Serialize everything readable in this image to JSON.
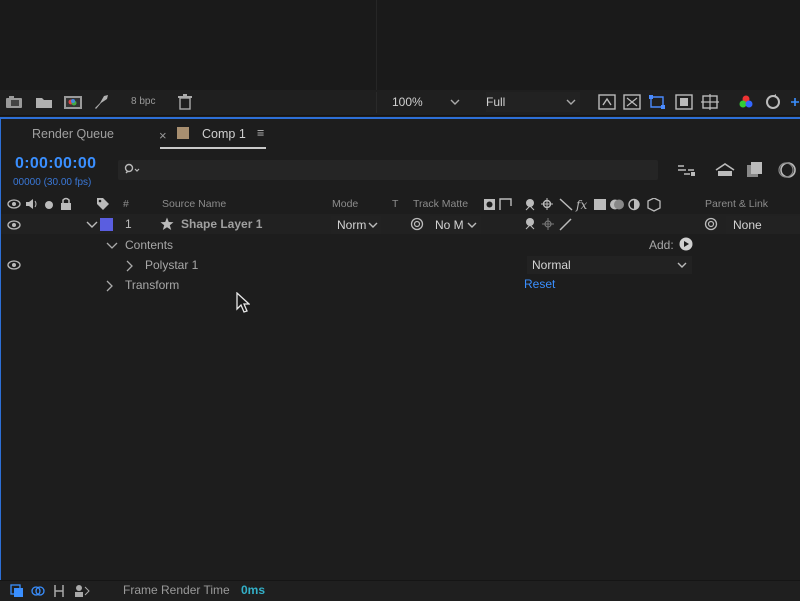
{
  "toolbar": {
    "bpc": "8 bpc",
    "zoom": "100%",
    "resolution": "Full",
    "icons": [
      "screenshot-icon",
      "folder-icon",
      "color-picture-icon",
      "rocket-icon",
      "trash-icon",
      "fast-preview-icon",
      "transparency-grid-icon",
      "mask-path-icon",
      "region-of-interest-icon",
      "grid-guides-icon",
      "channels-icon",
      "reset-exposure-icon"
    ],
    "accent": "#2d6fd6"
  },
  "tabs": {
    "render_queue": "Render Queue",
    "close": "×",
    "comp": "Comp 1",
    "menu": "≡"
  },
  "timeline": {
    "timecode": "0:00:00:00",
    "frame_info": "00000 (30.00 fps)",
    "timecode_color": "#3a8fff"
  },
  "columns": {
    "num": "#",
    "source_name": "Source Name",
    "mode": "Mode",
    "t": "T",
    "track_matte": "Track Matte",
    "parent_link": "Parent & Link"
  },
  "layer": {
    "number": "1",
    "name": "Shape Layer 1",
    "label_color": "#5a5ee0",
    "mode": "Norm",
    "track_matte": "No M",
    "parent": "None"
  },
  "properties": {
    "contents": "Contents",
    "add": "Add:",
    "polystar": "Polystar 1",
    "blend_mode": "Normal",
    "transform": "Transform",
    "reset": "Reset"
  },
  "footer": {
    "label": "Frame Render Time",
    "value": "0ms",
    "value_color": "#33b0c8"
  }
}
